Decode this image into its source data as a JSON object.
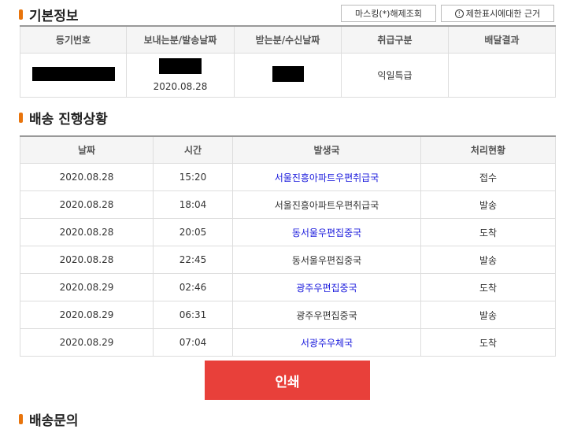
{
  "basic_info": {
    "title": "기본정보",
    "masking_button": "마스킹(*)해제조회",
    "notice_button_icon": "!",
    "notice_button": "제한표시에대한 근거",
    "headers": [
      "등기번호",
      "보내는분/발송날짜",
      "받는분/수신날짜",
      "취급구분",
      "배달결과"
    ],
    "send_date": "2020.08.28",
    "handling_type": "익일특급",
    "delivery_result": ""
  },
  "tracking": {
    "title": "배송 진행상황",
    "headers": [
      "날짜",
      "시간",
      "발생국",
      "처리현황"
    ],
    "rows": [
      {
        "date": "2020.08.28",
        "time": "15:20",
        "office": "서울진흥아파트우편취급국",
        "status": "접수"
      },
      {
        "date": "2020.08.28",
        "time": "18:04",
        "office": "서울진흥아파트우편취급국",
        "status": "발송"
      },
      {
        "date": "2020.08.28",
        "time": "20:05",
        "office": "동서울우편집중국",
        "status": "도착"
      },
      {
        "date": "2020.08.28",
        "time": "22:45",
        "office": "동서울우편집중국",
        "status": "발송"
      },
      {
        "date": "2020.08.29",
        "time": "02:46",
        "office": "광주우편집중국",
        "status": "도착"
      },
      {
        "date": "2020.08.29",
        "time": "06:31",
        "office": "광주우편집중국",
        "status": "발송"
      },
      {
        "date": "2020.08.29",
        "time": "07:04",
        "office": "서광주우체국",
        "status": "도착"
      }
    ]
  },
  "print_button": "인쇄",
  "next_section_title": "배송문의"
}
